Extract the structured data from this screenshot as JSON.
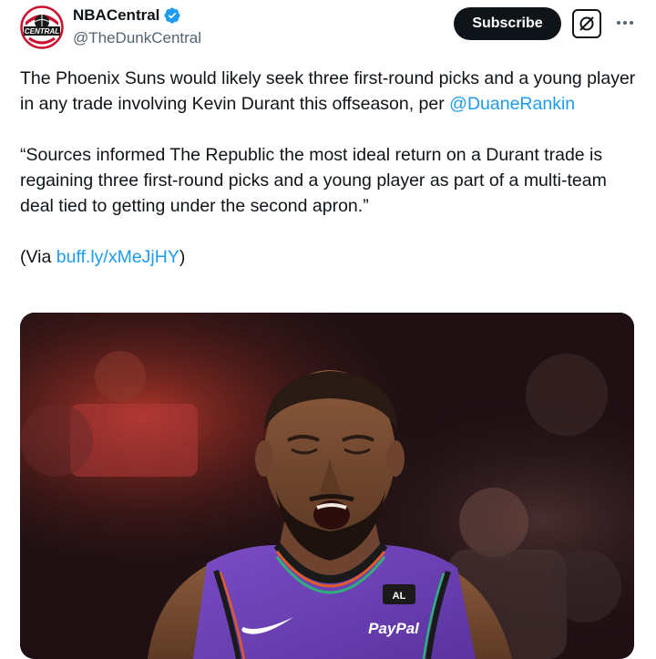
{
  "account": {
    "display_name": "NBACentral",
    "handle": "@TheDunkCentral",
    "avatar_text": "CENTRAL",
    "verified_icon": "verified-badge-icon"
  },
  "header": {
    "subscribe_label": "Subscribe",
    "grok_icon": "grok-icon",
    "more_icon": "more-options-icon"
  },
  "tweet": {
    "line1_text": "The Phoenix Suns would likely seek three first-round picks and a young player in any trade involving Kevin Durant this offseason, per ",
    "mention": "@DuaneRankin",
    "quote": "“Sources informed The Republic the most ideal return on a Durant trade is regaining three first-round picks and a young player as part of a multi-team deal tied to getting under the second apron.”",
    "via_prefix": "(Via ",
    "via_link": "buff.ly/xMeJjHY",
    "via_suffix": ")"
  },
  "media": {
    "jersey_text_1": "PayPal",
    "jersey_text_2": "AL"
  },
  "colors": {
    "text": "#0f1419",
    "secondary": "#536471",
    "link": "#1d9bf0",
    "verified": "#1d9bf0",
    "jersey_purple": "#6b3fb8"
  }
}
